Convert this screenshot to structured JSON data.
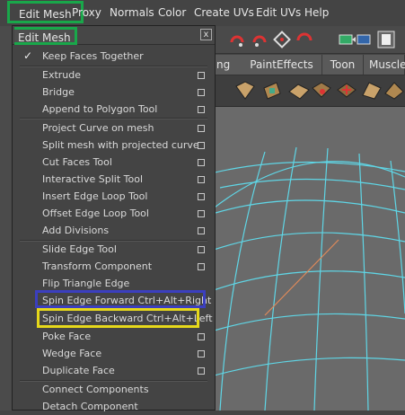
{
  "menubar": {
    "items": [
      {
        "label": "Edit Mesh"
      },
      {
        "label": "Proxy"
      },
      {
        "label": "Normals"
      },
      {
        "label": "Color"
      },
      {
        "label": "Create UVs"
      },
      {
        "label": "Edit UVs"
      },
      {
        "label": "Help"
      }
    ]
  },
  "shelf": {
    "tabs": [
      {
        "label": "ng"
      },
      {
        "label": "PaintEffects"
      },
      {
        "label": "Toon"
      },
      {
        "label": "Muscle"
      }
    ]
  },
  "menu": {
    "title": "Edit Mesh",
    "close": "x",
    "items": [
      {
        "label": "Keep Faces Together",
        "checked": true
      },
      {
        "label": "Extrude"
      },
      {
        "label": "Bridge"
      },
      {
        "label": "Append to Polygon Tool"
      },
      {
        "label": "Project Curve on mesh"
      },
      {
        "label": "Split mesh with projected curve"
      },
      {
        "label": "Cut Faces Tool"
      },
      {
        "label": "Interactive Split Tool"
      },
      {
        "label": "Insert Edge Loop Tool"
      },
      {
        "label": "Offset Edge Loop Tool"
      },
      {
        "label": "Add Divisions"
      },
      {
        "label": "Slide Edge Tool"
      },
      {
        "label": "Transform Component"
      },
      {
        "label": "Flip Triangle Edge"
      },
      {
        "label": "Spin Edge Forward  Ctrl+Alt+Right"
      },
      {
        "label": "Spin Edge Backward  Ctrl+Alt+Left"
      },
      {
        "label": "Poke Face"
      },
      {
        "label": "Wedge Face"
      },
      {
        "label": "Duplicate Face"
      },
      {
        "label": "Connect Components"
      },
      {
        "label": "Detach Component"
      }
    ],
    "check_glyph": "✓"
  },
  "colors": {
    "menu_highlight_green": "#19a74a",
    "spin_forward_highlight": "#3b3fbf",
    "spin_backward_highlight": "#e6d81a",
    "mesh_wire": "#5fd6e6",
    "selected_edge": "#e08a5a"
  },
  "icons": [
    "close-icon",
    "check-icon",
    "option-box-icon",
    "magnet-icon",
    "poly-tool-icon"
  ]
}
